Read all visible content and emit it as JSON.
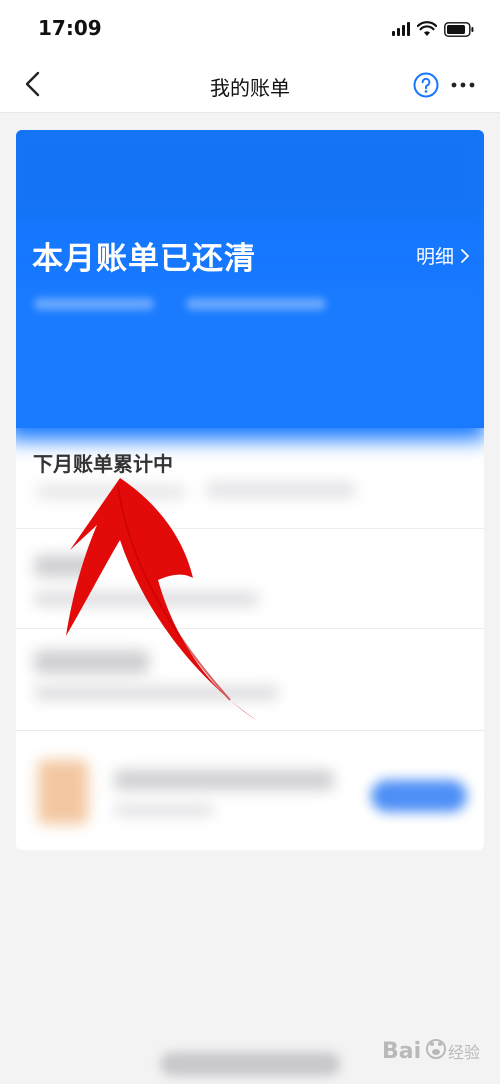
{
  "status_bar": {
    "time": "17:09"
  },
  "nav": {
    "title": "我的账单"
  },
  "bill_card": {
    "status_text": "本月账单已还清",
    "detail_link": "明细",
    "next_bill_title": "下月账单累计中"
  },
  "icons": {
    "back": "chevron-left-icon",
    "help": "question-circle-icon",
    "more": "more-dots-icon",
    "detail_arrow": "chevron-right-icon"
  },
  "colors": {
    "accent": "#1677ff",
    "annotation": "#e30a0a"
  },
  "watermark": {
    "text": "Bai 经验"
  }
}
